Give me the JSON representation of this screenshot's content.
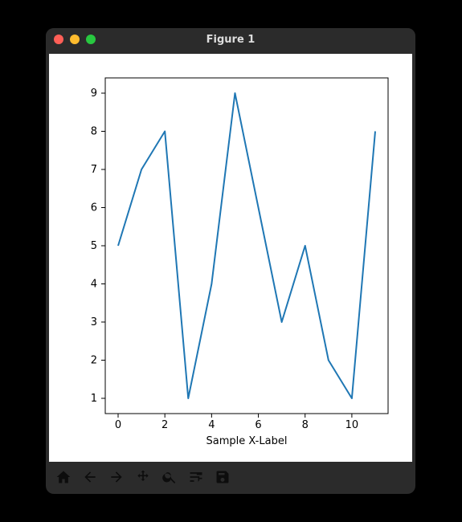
{
  "window": {
    "title": "Figure 1"
  },
  "toolbar": {
    "home": "Home",
    "back": "Back",
    "forward": "Forward",
    "pan": "Pan",
    "zoom": "Zoom",
    "configure": "Configure subplots",
    "save": "Save"
  },
  "chart_data": {
    "type": "line",
    "x": [
      0,
      1,
      2,
      3,
      4,
      5,
      6,
      7,
      8,
      9,
      10,
      11
    ],
    "y": [
      5,
      7,
      8,
      1,
      4,
      9,
      6,
      3,
      5,
      2,
      1,
      8
    ],
    "xlabel": "Sample X-Label",
    "ylabel": "",
    "title": "",
    "xticks": [
      0,
      2,
      4,
      6,
      8,
      10
    ],
    "yticks": [
      1,
      2,
      3,
      4,
      5,
      6,
      7,
      8,
      9
    ],
    "xlim": [
      -0.55,
      11.55
    ],
    "ylim": [
      0.6,
      9.4
    ],
    "line_color": "#1f77b4"
  }
}
